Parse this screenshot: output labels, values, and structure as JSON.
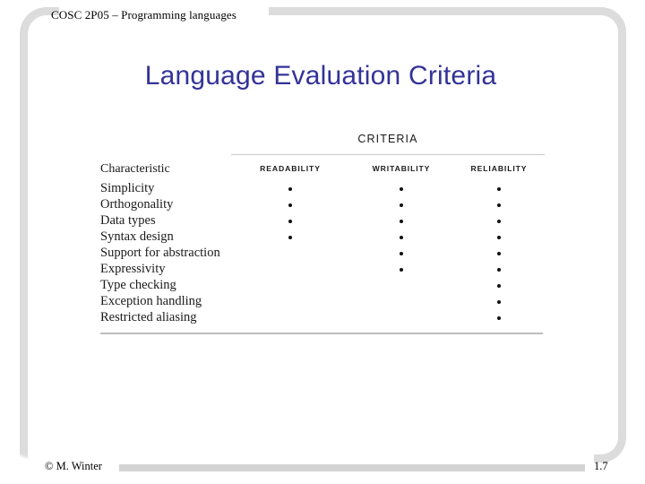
{
  "slide": {
    "course_header": "COSC 2P05 – Programming languages",
    "title": "Language Evaluation Criteria",
    "title_color": "#333399",
    "frame_color": "#dcdcdc",
    "background_color": "#ffffff"
  },
  "table": {
    "super_header": "CRITERIA",
    "row_header_label": "Characteristic",
    "columns": [
      "READABILITY",
      "WRITABILITY",
      "RELIABILITY"
    ],
    "rows": [
      {
        "label": "Simplicity",
        "readability": true,
        "writability": true,
        "reliability": true
      },
      {
        "label": "Orthogonality",
        "readability": true,
        "writability": true,
        "reliability": true
      },
      {
        "label": "Data types",
        "readability": true,
        "writability": true,
        "reliability": true
      },
      {
        "label": "Syntax design",
        "readability": true,
        "writability": true,
        "reliability": true
      },
      {
        "label": "Support for abstraction",
        "readability": false,
        "writability": true,
        "reliability": true
      },
      {
        "label": "Expressivity",
        "readability": false,
        "writability": true,
        "reliability": true
      },
      {
        "label": "Type checking",
        "readability": false,
        "writability": false,
        "reliability": true
      },
      {
        "label": "Exception handling",
        "readability": false,
        "writability": false,
        "reliability": true
      },
      {
        "label": "Restricted aliasing",
        "readability": false,
        "writability": false,
        "reliability": true
      }
    ],
    "mark_glyph": "bullet-dot"
  },
  "footer": {
    "copyright": "© M. Winter",
    "slide_number": "1.7"
  }
}
